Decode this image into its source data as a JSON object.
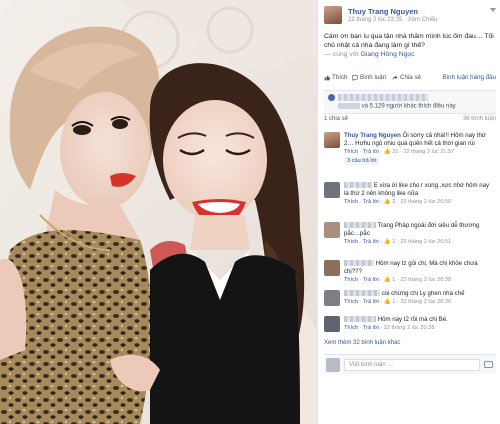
{
  "post": {
    "author": "Thuy Trang Nguyen",
    "meta": "22 tháng 2 lúc 23:35 · Xóm Chiếu",
    "text_1": "Cám ơn bạn iu qua tận nhà thăm mình lúc ốm đau… Tối chủ nhật cả nhà đang làm gì thế?",
    "text_2_prefix": "— cùng với ",
    "tagged": "Giang Hồng Ngọc"
  },
  "actions": {
    "like": "Thích",
    "comment": "Bình luận",
    "share": "Chia sẻ"
  },
  "top_right_link": "Bình luận hàng đầu",
  "likes": {
    "summary_suffix": "và 5.129 người khác thích điều này"
  },
  "shares": {
    "count": "1 chia sẻ",
    "comments": "36 bình luận"
  },
  "comments": [
    {
      "name": "Thuy Trang Nguyen",
      "text": " Ôi sorry cả nhà!!! Hôm nay thứ 2… Hưhu ngủ nhiu quá quên hết cả thời gian rùi",
      "like": "Thích",
      "reply": "Trả lời",
      "count": "31",
      "time": "22 tháng 2 lúc 21:57",
      "replies": "3 câu trả lời"
    },
    {
      "text": " E vừa ời like cho r xong..xực nhớ hôm nay là thứ 2 nên không like nữa",
      "like": "Thích",
      "reply": "Trả lời",
      "count": "2",
      "time": "22 tháng 2 lúc 20:50"
    },
    {
      "text": "Trang Pháp ngoài đời siêu dễ thương pắc…pắc",
      "like": "Thích",
      "reply": "Trả lời",
      "count": "1",
      "time": "22 tháng 2 lúc 20:51"
    },
    {
      "text": " Hôm nay tz gỏi chị. Mà chị khỏe chưa chị???",
      "like": "Thích",
      "reply": "Trả lời",
      "count": "1",
      "time": "22 tháng 2 lúc 20:38"
    },
    {
      "text": " coi chừng chị Ly ghen nha chế",
      "like": "Thích",
      "reply": "Trả lời",
      "count": "1",
      "time": "22 tháng 2 lúc 20:36"
    },
    {
      "text": " Hôm nay t2 rồi mà chị Bé.",
      "like": "Thích",
      "reply": "Trả lời",
      "time": "22 tháng 2 lúc 20:38"
    }
  ],
  "more_comments": "Xem thêm 32 bình luận khác",
  "write_placeholder": "Viết bình luận …",
  "colors": {
    "link": "#365899",
    "meta": "#90949c",
    "like_blue": "#4267b2",
    "lip": "#d8322f"
  },
  "icons": [
    "chevron-down-icon",
    "like-icon",
    "comment-icon",
    "share-icon",
    "camera-icon"
  ]
}
